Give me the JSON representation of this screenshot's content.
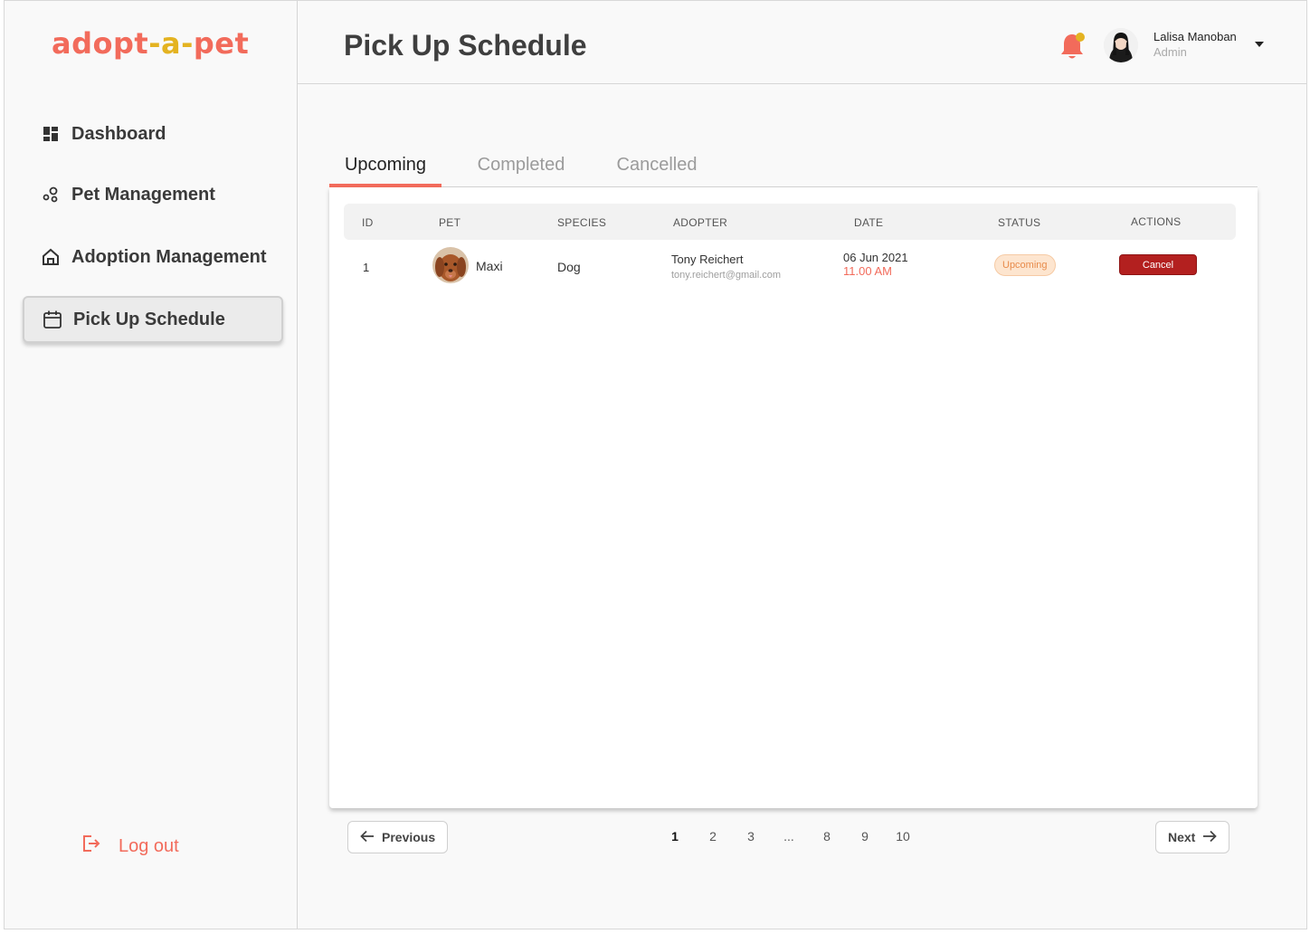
{
  "sidebar": {
    "logo": {
      "part1": "adopt",
      "part2": "-a-",
      "part3": "pet"
    },
    "items": [
      {
        "label": "Dashboard",
        "icon": "dashboard-icon"
      },
      {
        "label": "Pet Management",
        "icon": "pet-management-icon"
      },
      {
        "label": "Adoption Management",
        "icon": "home-icon"
      },
      {
        "label": "Pick Up Schedule",
        "icon": "calendar-icon",
        "active": true
      }
    ],
    "logout": "Log out"
  },
  "header": {
    "title": "Pick Up Schedule",
    "user": {
      "name": "Lalisa Manoban",
      "role": "Admin"
    }
  },
  "tabs": [
    {
      "label": "Upcoming",
      "active": true
    },
    {
      "label": "Completed"
    },
    {
      "label": "Cancelled"
    }
  ],
  "table": {
    "columns": [
      "ID",
      "PET",
      "SPECIES",
      "ADOPTER",
      "DATE",
      "STATUS",
      "ACTIONS"
    ],
    "rows": [
      {
        "id": "1",
        "pet": "Maxi",
        "species": "Dog",
        "adopter_name": "Tony Reichert",
        "adopter_email": "tony.reichert@gmail.com",
        "date": "06 Jun 2021",
        "time": "11.00 AM",
        "status": "Upcoming",
        "action": "Cancel"
      }
    ]
  },
  "pagination": {
    "previous": "Previous",
    "next": "Next",
    "pages": [
      "1",
      "2",
      "3",
      "...",
      "8",
      "9",
      "10"
    ],
    "current": "1"
  },
  "colors": {
    "brand": "#f26b5b",
    "brand_accent": "#e4b321",
    "danger": "#b3201f",
    "badge_bg": "#fde5cf"
  }
}
